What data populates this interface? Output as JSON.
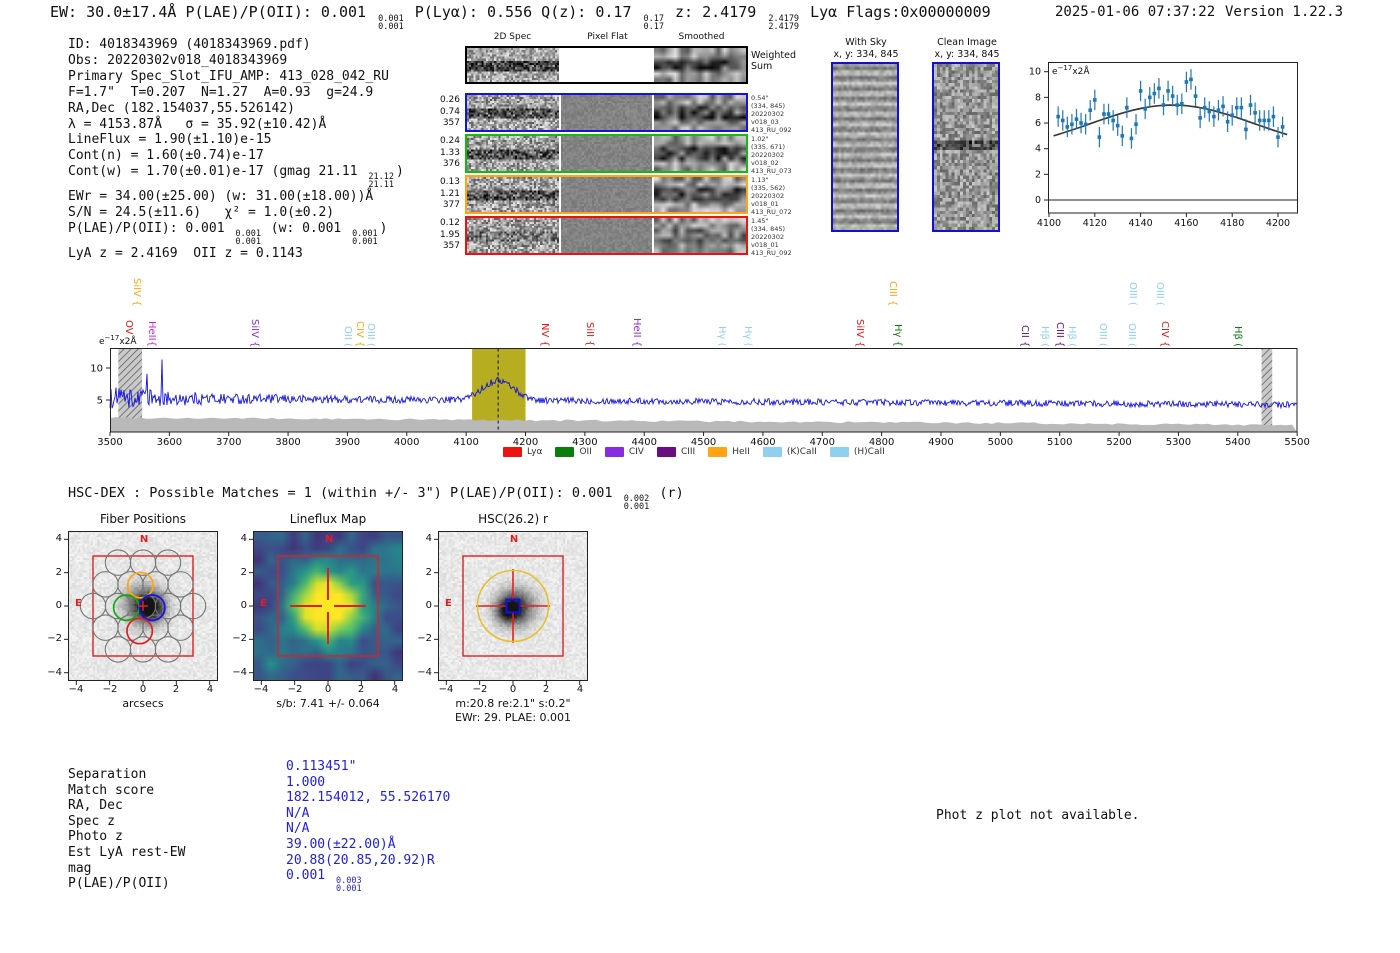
{
  "header": {
    "line": "EW: 30.0±17.4Å  P(LAE)/P(OII): 0.001 [0.001/0.001]  P(Lyα): 0.556  Q(z): 0.17 [0.17/0.17]  z: 2.4179 [2.4179/2.4179] Lyα  Flags:0x00000009",
    "datetime": "2025-01-06 07:37:22",
    "version": "Version 1.22.3"
  },
  "info_lines": [
    "ID: 4018343969 (4018343969.pdf)",
    "Obs: 20220302v018_4018343969",
    "Primary Spec_Slot_IFU_AMP: 413_028_042_RU",
    "F=1.7\"  T=0.207  N=1.27  A=0.93  g=24.9",
    "RA,Dec (182.154037,55.526142)",
    "λ = 4153.87Å   σ = 35.92(±10.42)Å",
    "LineFlux = 1.90(±1.10)e-15",
    "Cont(n) = 1.60(±0.74)e-17",
    "Cont(w) = 1.70(±0.01)e-17 (gmag 21.11 [21.12/21.11])",
    "EWr = 34.00(±25.00) (w: 31.00(±18.00))Å",
    "S/N = 24.5(±11.6)   χ² = 1.0(±0.2)",
    "P(LAE)/P(OII): 0.001 [0.001/0.001] (w: 0.001 [0.001/0.001])",
    "LyA z = 2.4169  OII z = 0.1143"
  ],
  "spec2d": {
    "col_titles": [
      "2D Spec",
      "Pixel Flat",
      "Smoothed"
    ],
    "weighted_label": "Weighted Sum",
    "rows": [
      {
        "color": "#1111ee",
        "left": [
          "0.26",
          "0.74",
          "357"
        ],
        "right": [
          "0.54\"",
          "(334, 845)",
          "20220302",
          "v018_03",
          "413_RU_092"
        ]
      },
      {
        "color": "#11bb11",
        "left": [
          "0.24",
          "1.33",
          "376"
        ],
        "right": [
          "1.02\"",
          "(335, 671)",
          "20220302",
          "v018_02",
          "413_RU_073"
        ]
      },
      {
        "color": "#ffa511",
        "left": [
          "0.13",
          "1.21",
          "377"
        ],
        "right": [
          "1.13\"",
          "(335, 562)",
          "20220302",
          "v018_01",
          "413_RU_072"
        ]
      },
      {
        "color": "#ee1111",
        "left": [
          "0.12",
          "1.95",
          "357"
        ],
        "right": [
          "1.45\"",
          "(334, 845)",
          "20220302",
          "v018_01",
          "413_RU_092"
        ]
      }
    ]
  },
  "sky_panels": {
    "with_sky": {
      "title": "With Sky",
      "xy": "x, y: 334, 845"
    },
    "clean": {
      "title": "Clean Image",
      "xy": "x, y: 334, 845"
    }
  },
  "hsc_line": "HSC-DEX : Possible Matches = 1 (within +/- 3\")  P(LAE)/P(OII): 0.001 [0.002/0.001] (r)",
  "cutouts": {
    "axis_ticks": [
      -4,
      -2,
      0,
      2,
      4
    ],
    "north_label": "N",
    "east_label": "E",
    "fiber": {
      "title": "Fiber Positions",
      "xlabel": "arcsecs"
    },
    "lineflux": {
      "title": "Lineflux Map",
      "caption": "s/b: 7.41 +/- 0.064"
    },
    "hsc": {
      "title": "HSC(26.2) r",
      "caption1": "m:20.8  re:2.1\"  s:0.2\"",
      "caption2": "EWr: 29. PLAE: 0.001"
    }
  },
  "match_table": {
    "rows": [
      {
        "label": "Separation",
        "value": "0.113451\""
      },
      {
        "label": "Match score",
        "value": "1.000"
      },
      {
        "label": "RA, Dec",
        "value": "182.154012, 55.526170"
      },
      {
        "label": "Spec z",
        "value": "N/A"
      },
      {
        "label": "Photo z",
        "value": "N/A"
      },
      {
        "label": "Est LyA rest-EW",
        "value": "39.00(±22.00)Å"
      },
      {
        "label": "mag",
        "value": "20.88(20.85,20.92)R"
      },
      {
        "label": "P(LAE)/P(OII)",
        "value": "0.001 [0.003/0.001]"
      }
    ]
  },
  "phot_z_note": "Phot z plot not available.",
  "chart_data": [
    {
      "id": "emission_line_fit",
      "type": "scatter",
      "ylabel": {
        "base": "e",
        "sup": "−17",
        "rest": "x2Å"
      },
      "xlim": [
        4095,
        4208
      ],
      "ylim": [
        -0.6,
        10.8
      ],
      "xticks": [
        4100,
        4120,
        4140,
        4160,
        4180,
        4200
      ],
      "yticks": [
        0,
        2,
        4,
        6,
        8,
        10
      ],
      "marker_color": "#1f77b4",
      "fit_color": "#3a3a3a",
      "yerr": 0.8,
      "x": [
        4104,
        4106,
        4108,
        4110,
        4112,
        4114,
        4116,
        4118,
        4120,
        4122,
        4124,
        4126,
        4128,
        4130,
        4132,
        4134,
        4136,
        4138,
        4140,
        4142,
        4144,
        4146,
        4148,
        4150,
        4152,
        4154,
        4156,
        4158,
        4160,
        4162,
        4164,
        4166,
        4168,
        4170,
        4172,
        4174,
        4176,
        4178,
        4180,
        4182,
        4184,
        4186,
        4188,
        4190,
        4192,
        4194,
        4196,
        4198,
        4200,
        4202
      ],
      "y": [
        6.5,
        6.2,
        5.7,
        5.9,
        6.3,
        6.0,
        5.9,
        7.0,
        7.8,
        4.9,
        6.7,
        6.7,
        6.2,
        5.8,
        5.0,
        7.2,
        4.8,
        5.9,
        8.5,
        7.1,
        8.0,
        8.3,
        8.7,
        7.4,
        8.5,
        8.1,
        7.4,
        7.5,
        9.2,
        9.4,
        8.1,
        6.4,
        7.2,
        6.9,
        6.5,
        7.0,
        7.3,
        6.1,
        6.6,
        7.2,
        7.2,
        5.5,
        7.4,
        6.8,
        6.2,
        6.2,
        6.2,
        6.5,
        4.9,
        5.7
      ],
      "fit": {
        "center": 4153.87,
        "sigma": 35.92,
        "amplitude": 3.7,
        "offset": 3.7
      }
    },
    {
      "id": "full_spectrum",
      "type": "line",
      "ylabel": {
        "base": "e",
        "sup": "−17",
        "rest": "x2Å"
      },
      "xlim": [
        3483,
        5520
      ],
      "ylim": [
        0,
        13.1
      ],
      "xticks": [
        3500,
        3600,
        3700,
        3800,
        3900,
        4000,
        4100,
        4200,
        4300,
        4400,
        4500,
        4600,
        4700,
        4800,
        4900,
        5000,
        5100,
        5200,
        5300,
        5400,
        5500
      ],
      "yticks": [
        5,
        10
      ],
      "line_color": "#1414dd",
      "noise_floor_color": "#b9b9b9",
      "highlight": {
        "x0": 4110,
        "x1": 4200,
        "color": "#b7ad20"
      },
      "dashed_line_x": 4153.9,
      "hatched_bands": [
        [
          3514,
          3554
        ],
        [
          5440,
          5458
        ]
      ],
      "legend": [
        {
          "label": "Lyα",
          "color": "#ee1111"
        },
        {
          "label": "OII",
          "color": "#0a7d0a"
        },
        {
          "label": "CIV",
          "color": "#8a2be2"
        },
        {
          "label": "CIII",
          "color": "#6a0d83"
        },
        {
          "label": "HeII",
          "color": "#ffa511"
        },
        {
          "label": "(K)CaII",
          "color": "#8fd0ee"
        },
        {
          "label": "(H)CaII",
          "color": "#8fd0ee"
        }
      ],
      "line_markers": [
        {
          "label": "SiIV {",
          "wave": 3545,
          "color": "#ffa511",
          "tier": 2
        },
        {
          "label": "OVI {",
          "wave": 3532,
          "color": "#ee1111",
          "tier": 1
        },
        {
          "label": "HeII{",
          "wave": 3571,
          "color": "#cc22cc",
          "tier": 1
        },
        {
          "label": "SiIV {",
          "wave": 3744,
          "color": "#8a2be2",
          "tier": 1
        },
        {
          "label": "OII (",
          "wave": 3901,
          "color": "#8fd0ee",
          "tier": 1
        },
        {
          "label": "CIV {",
          "wave": 3921,
          "color": "#ffa511",
          "tier": 1
        },
        {
          "label": "OIII (",
          "wave": 3940,
          "color": "#8fd0ee",
          "tier": 1
        },
        {
          "label": "NV {",
          "wave": 4233,
          "color": "#ee1111",
          "tier": 1
        },
        {
          "label": "SiII {",
          "wave": 4309,
          "color": "#ee1111",
          "tier": 1
        },
        {
          "label": "HeII {",
          "wave": 4388,
          "color": "#8a2be2",
          "tier": 1
        },
        {
          "label": "Hγ (",
          "wave": 4531,
          "color": "#8fd0ee",
          "tier": 1
        },
        {
          "label": "Hγ (",
          "wave": 4575,
          "color": "#8fd0ee",
          "tier": 1
        },
        {
          "label": "SiIV {",
          "wave": 4764,
          "color": "#ee1111",
          "tier": 1
        },
        {
          "label": "CIII {",
          "wave": 4819,
          "color": "#ffa511",
          "tier": 2
        },
        {
          "label": "Hγ {",
          "wave": 4828,
          "color": "#0a7d0a",
          "tier": 1
        },
        {
          "label": "CII {",
          "wave": 5042,
          "color": "#6a0d83",
          "tier": 1
        },
        {
          "label": "Hβ (",
          "wave": 5075,
          "color": "#8fd0ee",
          "tier": 1
        },
        {
          "label": "CIII {",
          "wave": 5101,
          "color": "#6a0d83",
          "tier": 1
        },
        {
          "label": "Hβ (",
          "wave": 5121,
          "color": "#8fd0ee",
          "tier": 1
        },
        {
          "label": "OIII (",
          "wave": 5173,
          "color": "#8fd0ee",
          "tier": 1
        },
        {
          "label": "OIII (",
          "wave": 5222,
          "color": "#8fd0ee",
          "tier": 1
        },
        {
          "label": "OIII (",
          "wave": 5224,
          "color": "#8fd0ee",
          "tier": 2
        },
        {
          "label": "OIII (",
          "wave": 5269,
          "color": "#8fd0ee",
          "tier": 2
        },
        {
          "label": "CIV {",
          "wave": 5277,
          "color": "#ee1111",
          "tier": 1
        },
        {
          "label": "Hβ (",
          "wave": 5400,
          "color": "#0a7d0a",
          "tier": 1
        }
      ]
    }
  ]
}
